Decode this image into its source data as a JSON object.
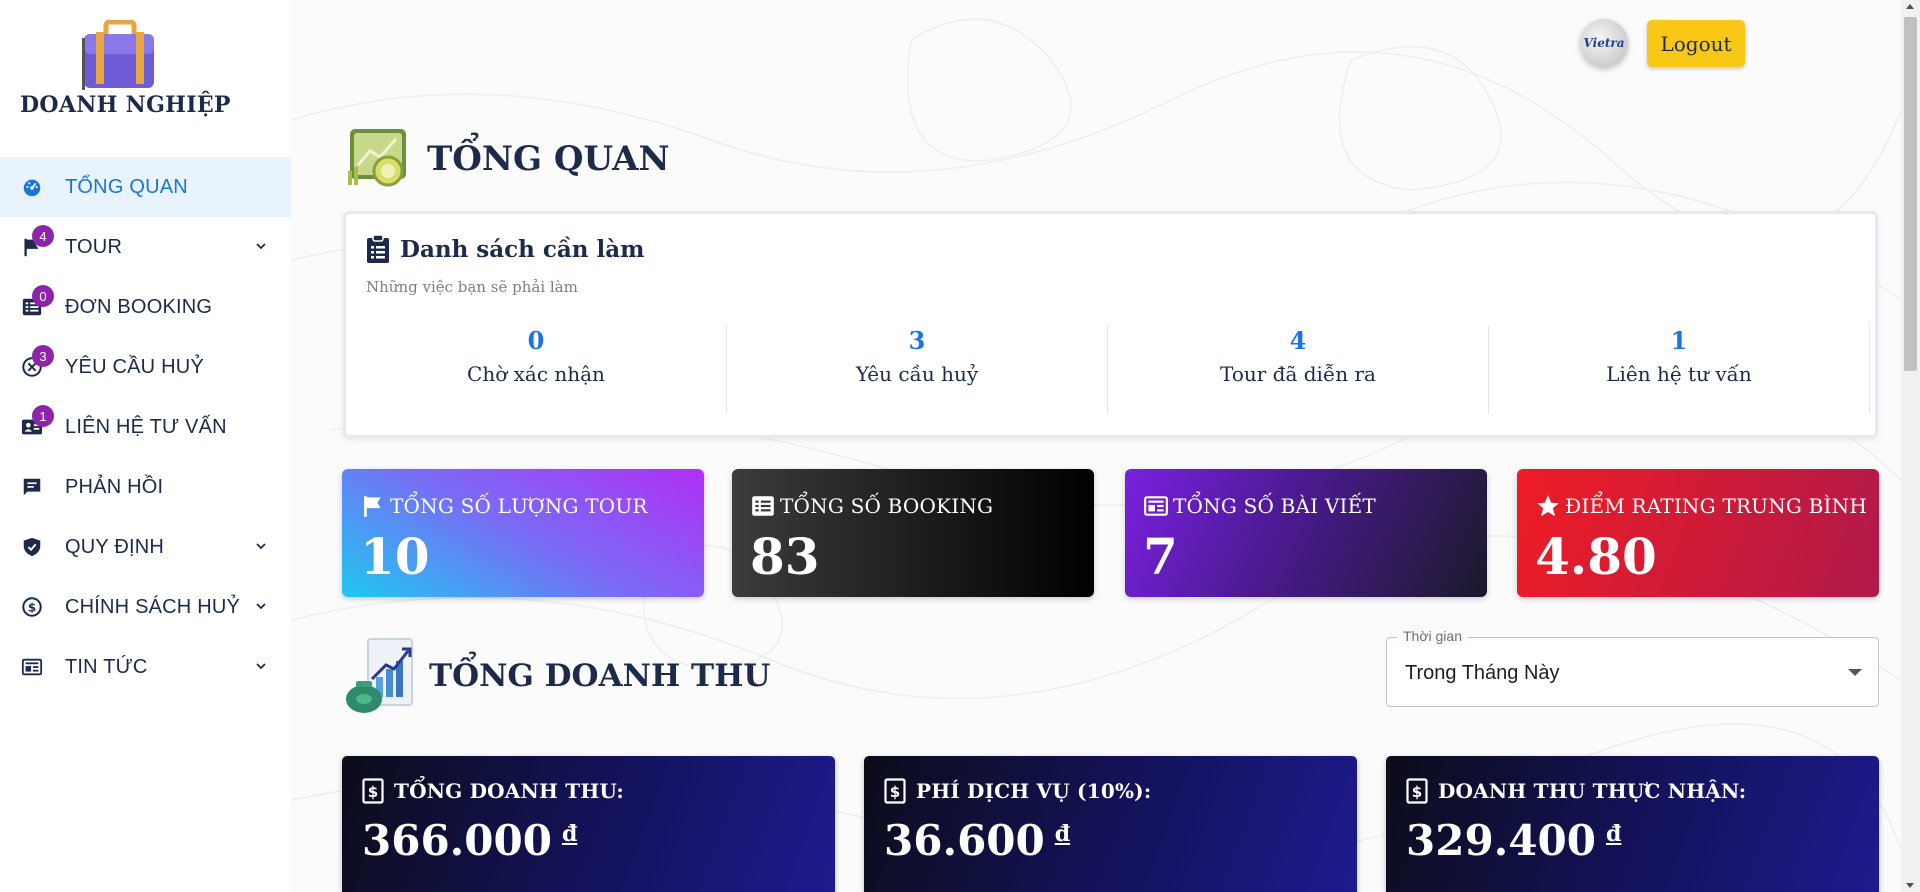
{
  "brand": {
    "name": "DOANH NGHIỆP",
    "logo_icon": "briefcase-icon"
  },
  "sidebar": {
    "items": [
      {
        "label": "TỔNG QUAN",
        "icon": "dashboard-icon",
        "active": true
      },
      {
        "label": "TOUR",
        "icon": "flag-icon",
        "badge": "4",
        "has_submenu": true
      },
      {
        "label": "ĐƠN BOOKING",
        "icon": "list-icon",
        "badge": "0"
      },
      {
        "label": "YÊU CẦU HUỶ",
        "icon": "cancel-circle-icon",
        "badge": "3"
      },
      {
        "label": "LIÊN HỆ TƯ VẤN",
        "icon": "contact-card-icon",
        "badge": "1"
      },
      {
        "label": "PHẢN HỒI",
        "icon": "chat-icon"
      },
      {
        "label": "QUY ĐỊNH",
        "icon": "shield-icon",
        "has_submenu": true
      },
      {
        "label": "CHÍNH SÁCH HUỶ",
        "icon": "dollar-icon",
        "has_submenu": true
      },
      {
        "label": "TIN TỨC",
        "icon": "newspaper-icon",
        "has_submenu": true
      }
    ]
  },
  "header": {
    "avatar_text": "Vietra",
    "logout_label": "Logout"
  },
  "main": {
    "title": "TỔNG QUAN",
    "todo": {
      "title": "Danh sách cần làm",
      "subtitle": "Những việc bạn sẽ phải làm",
      "stats": [
        {
          "value": "0",
          "label": "Chờ xác nhận"
        },
        {
          "value": "3",
          "label": "Yêu cầu huỷ"
        },
        {
          "value": "4",
          "label": "Tour đã diễn ra"
        },
        {
          "value": "1",
          "label": "Liên hệ tư vấn"
        }
      ]
    },
    "stat_cards": [
      {
        "label": "TỔNG SỐ LƯỢNG TOUR",
        "value": "10",
        "icon": "flag-icon"
      },
      {
        "label": "TỔNG SỐ BOOKING",
        "value": "83",
        "icon": "list-icon"
      },
      {
        "label": "TỔNG SỐ BÀI VIẾT",
        "value": "7",
        "icon": "newspaper-icon"
      },
      {
        "label": "ĐIỂM RATING TRUNG BÌNH",
        "value": "4.80",
        "icon": "star-icon"
      }
    ],
    "revenue": {
      "title": "TỔNG DOANH THU",
      "period_select": {
        "label": "Thời gian",
        "value": "Trong Tháng Này"
      },
      "cards": [
        {
          "label": "TỔNG DOANH THU:",
          "value": "366.000",
          "currency": "đ"
        },
        {
          "label": "PHÍ DỊCH VỤ (10%):",
          "value": "36.600",
          "currency": "đ"
        },
        {
          "label": "DOANH THU THỰC NHẬN:",
          "value": "329.400",
          "currency": "đ"
        }
      ]
    }
  },
  "colors": {
    "accent": "#1976d2",
    "badge": "#8e24aa",
    "logout": "#f9c716",
    "text_dark": "#1e2a4a"
  }
}
